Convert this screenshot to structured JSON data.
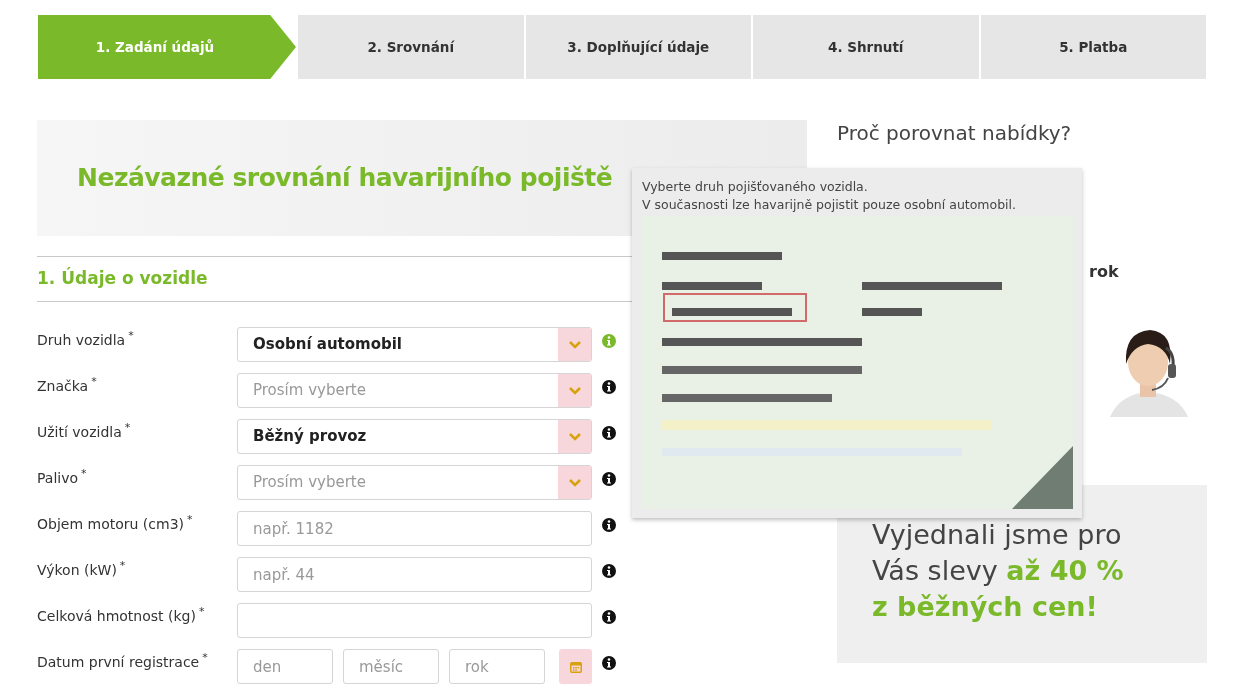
{
  "steps": [
    {
      "label": "1. Zadání údajů",
      "selected": true
    },
    {
      "label": "2. Srovnání",
      "selected": false
    },
    {
      "label": "3. Doplňující údaje",
      "selected": false
    },
    {
      "label": "4. Shrnutí",
      "selected": false
    },
    {
      "label": "5. Platba",
      "selected": false
    }
  ],
  "heading": "Nezávazné srovnání havarijního pojiště",
  "section_title": "1. Údaje o vozidle",
  "fields": [
    {
      "label": "Druh vozidla",
      "required_mark": "*",
      "kind": "select",
      "value": "Osobní automobil",
      "info_active": true
    },
    {
      "label": "Značka",
      "required_mark": "*",
      "kind": "select",
      "placeholder": "Prosím vyberte",
      "info_active": false
    },
    {
      "label": "Užití vozidla",
      "required_mark": "*",
      "kind": "select",
      "value": "Běžný provoz",
      "info_active": false
    },
    {
      "label": "Palivo",
      "required_mark": "*",
      "kind": "select",
      "placeholder": "Prosím vyberte",
      "info_active": false
    },
    {
      "label": "Objem motoru (cm3)",
      "required_mark": "*",
      "kind": "input",
      "placeholder": "např. 1182",
      "info_active": false
    },
    {
      "label": "Výkon (kW)",
      "required_mark": "*",
      "kind": "input",
      "placeholder": "např. 44",
      "info_active": false
    },
    {
      "label": "Celková hmotnost (kg)",
      "required_mark": "*",
      "kind": "input",
      "info_active": false
    },
    {
      "label": "Datum první registrace",
      "required_mark": "*",
      "kind": "date",
      "parts": [
        {
          "placeholder": "den"
        },
        {
          "placeholder": "měsíc"
        },
        {
          "placeholder": "rok"
        }
      ],
      "info_active": false
    }
  ],
  "sidebar": {
    "title": "Proč porovnat nabídky?",
    "partial_text": "rok",
    "promo": "Vyjednali jsme pro Vás slevy **až 40 % z běžných cen!**"
  },
  "tooltip": {
    "lines": [
      "Vyberte druh pojišťovaného vozidla.",
      "V současnosti lze havarijně pojistit pouze osobní automobil."
    ],
    "image": {
      "kind": "picture"
    }
  }
}
